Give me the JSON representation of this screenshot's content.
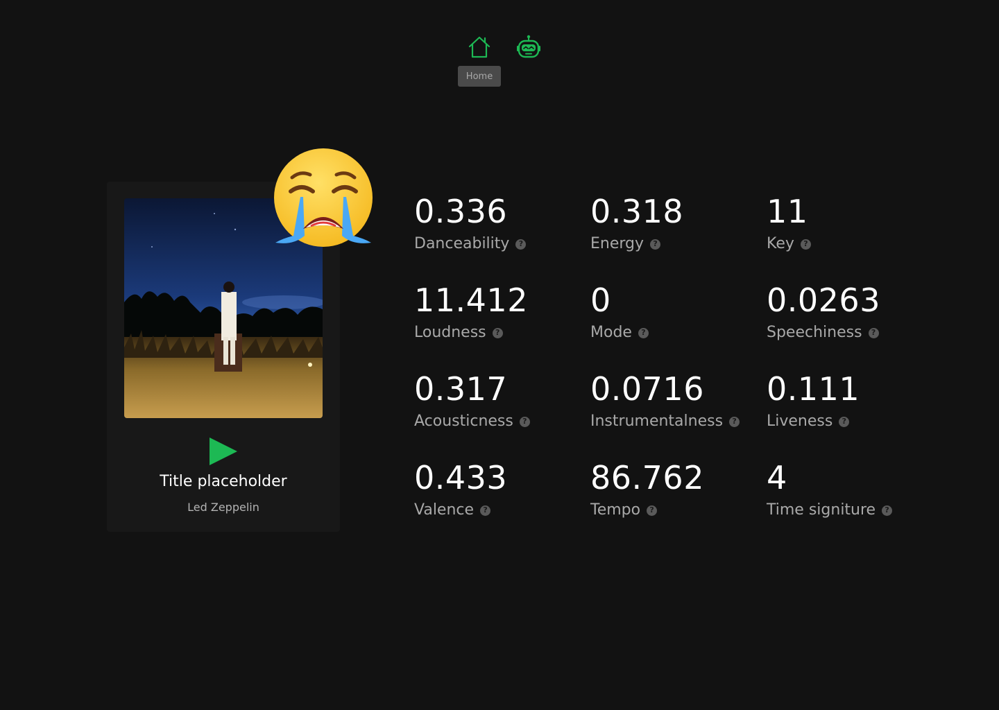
{
  "nav": {
    "home_icon": "home-icon",
    "robot_icon": "robot-icon",
    "tooltip": "Home",
    "accent_color": "#1db954"
  },
  "track": {
    "title": "Title placeholder",
    "artist": "Led Zeppelin",
    "mood_emoji": "loudly-crying-face",
    "play_icon": "play-icon",
    "cover_image": "album cover photo"
  },
  "stats": [
    {
      "value": "0.336",
      "label": "Danceability"
    },
    {
      "value": "0.318",
      "label": "Energy"
    },
    {
      "value": "11",
      "label": "Key"
    },
    {
      "value": "11.412",
      "label": "Loudness"
    },
    {
      "value": "0",
      "label": "Mode"
    },
    {
      "value": "0.0263",
      "label": "Speechiness"
    },
    {
      "value": "0.317",
      "label": "Acousticness"
    },
    {
      "value": "0.0716",
      "label": "Instrumentalness"
    },
    {
      "value": "0.111",
      "label": "Liveness"
    },
    {
      "value": "0.433",
      "label": "Valence"
    },
    {
      "value": "86.762",
      "label": "Tempo"
    },
    {
      "value": "4",
      "label": "Time signiture"
    }
  ],
  "help_glyph": "?"
}
